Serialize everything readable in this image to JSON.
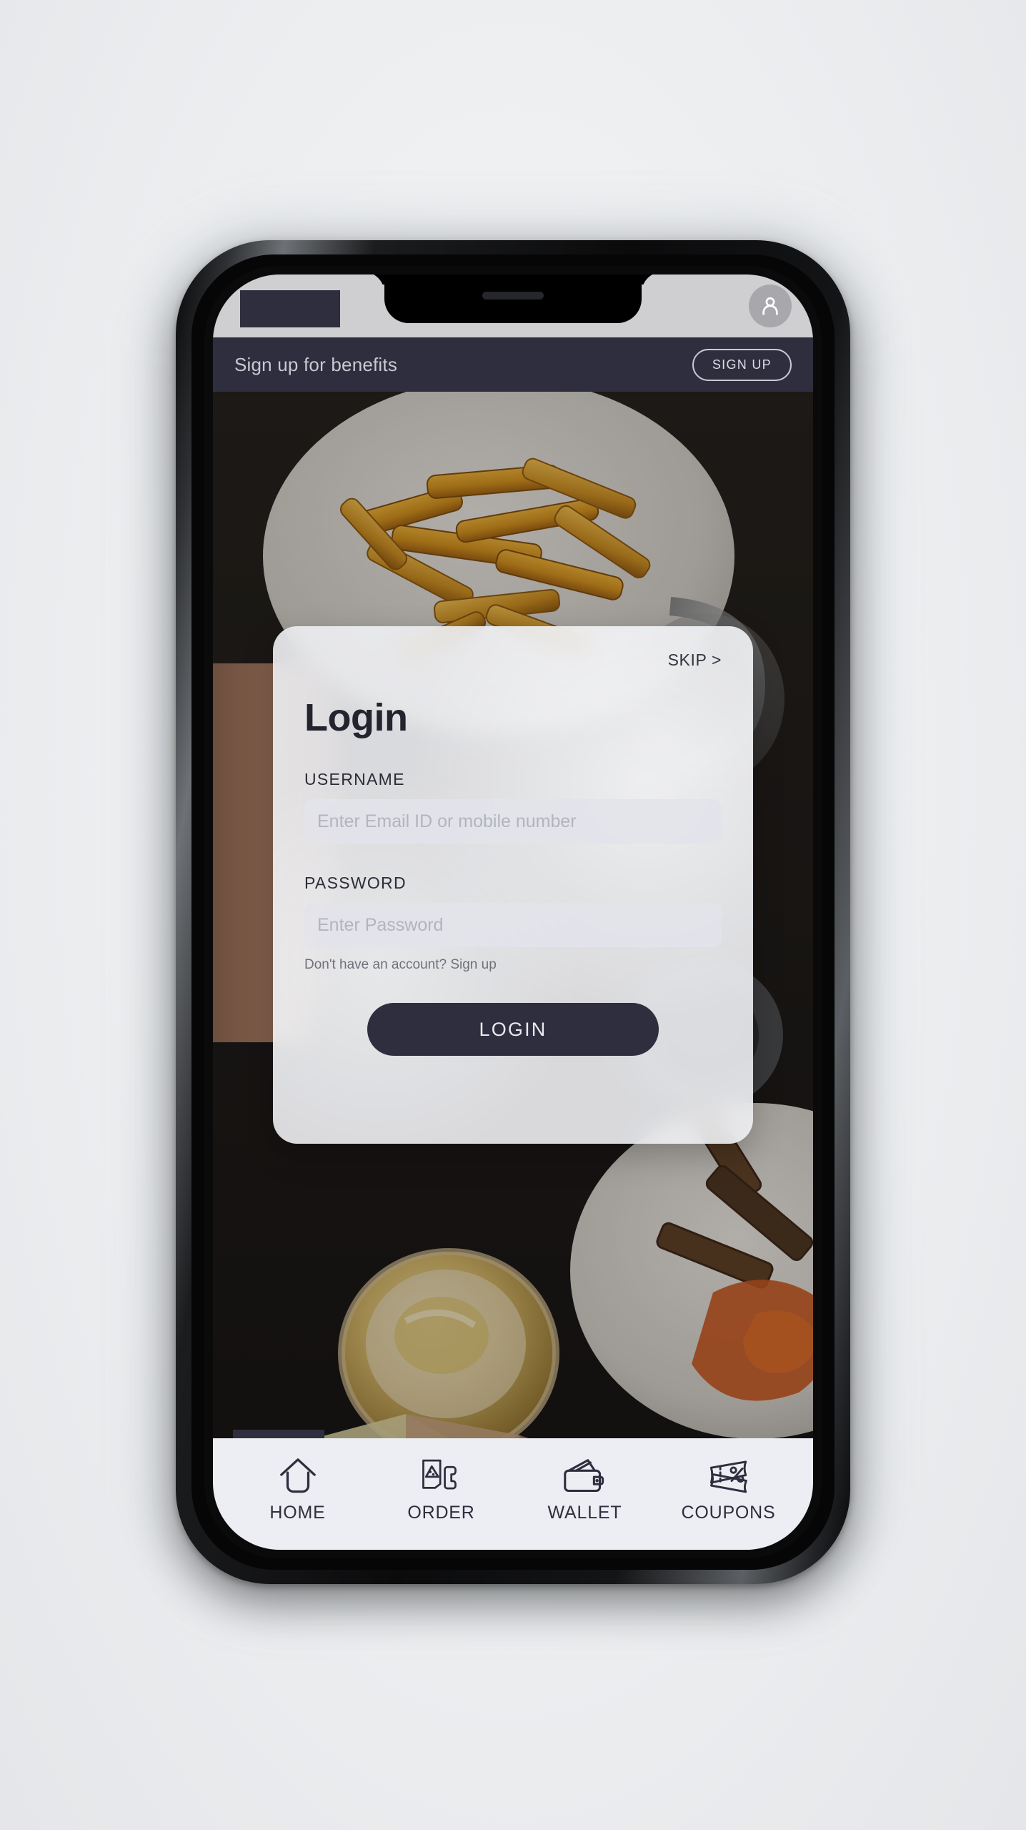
{
  "app": {
    "screen_name": "Login",
    "brand_color": "#2e2e3e",
    "card_color": "#eeeff3"
  },
  "statusbar": {
    "logo_placeholder": "",
    "avatar_icon": "person-avatar-icon"
  },
  "promo_banner": {
    "text": "Sign up for benefits",
    "button_label": "SIGN UP"
  },
  "login_card": {
    "skip_label": "SKIP >",
    "title": "Login",
    "username": {
      "label": "USERNAME",
      "placeholder": "Enter Email ID or mobile number",
      "value": ""
    },
    "password": {
      "label": "PASSWORD",
      "placeholder": "Enter Password",
      "value": ""
    },
    "helper_text": "Don't have an account? Sign up",
    "submit_label": "LOGIN"
  },
  "bottom_nav": {
    "active_index": 0,
    "items": [
      {
        "label": "HOME",
        "icon": "home-icon"
      },
      {
        "label": "ORDER",
        "icon": "pizza-phone-icon"
      },
      {
        "label": "WALLET",
        "icon": "wallet-icon"
      },
      {
        "label": "COUPONS",
        "icon": "coupon-percent-icon"
      }
    ]
  }
}
